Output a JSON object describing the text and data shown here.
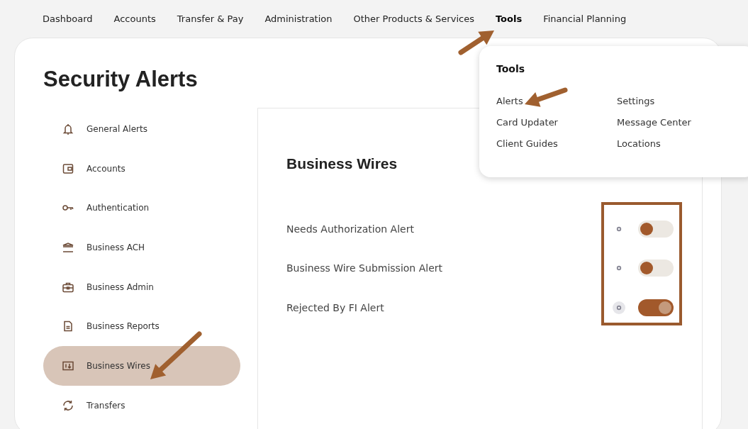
{
  "nav": [
    {
      "label": "Dashboard",
      "selected": false
    },
    {
      "label": "Accounts",
      "selected": false
    },
    {
      "label": "Transfer & Pay",
      "selected": false
    },
    {
      "label": "Administration",
      "selected": false
    },
    {
      "label": "Other Products & Services",
      "selected": false
    },
    {
      "label": "Tools",
      "selected": true
    },
    {
      "label": "Financial Planning",
      "selected": false
    }
  ],
  "page_title": "Security Alerts",
  "sidebar": [
    {
      "label": "General Alerts",
      "selected": false
    },
    {
      "label": "Accounts",
      "selected": false
    },
    {
      "label": "Authentication",
      "selected": false
    },
    {
      "label": "Business ACH",
      "selected": false
    },
    {
      "label": "Business Admin",
      "selected": false
    },
    {
      "label": "Business Reports",
      "selected": false
    },
    {
      "label": "Business Wires",
      "selected": true
    },
    {
      "label": "Transfers",
      "selected": false
    }
  ],
  "panel": {
    "title": "Business Wires",
    "alerts": [
      {
        "label": "Needs Authorization Alert",
        "on": false,
        "hovered": false
      },
      {
        "label": "Business Wire Submission Alert",
        "on": false,
        "hovered": false
      },
      {
        "label": "Rejected By FI Alert",
        "on": true,
        "hovered": true
      }
    ]
  },
  "menu": {
    "title": "Tools",
    "columns": [
      [
        "Alerts",
        "Card Updater",
        "Client Guides"
      ],
      [
        "Settings",
        "Message Center",
        "Locations"
      ]
    ]
  }
}
